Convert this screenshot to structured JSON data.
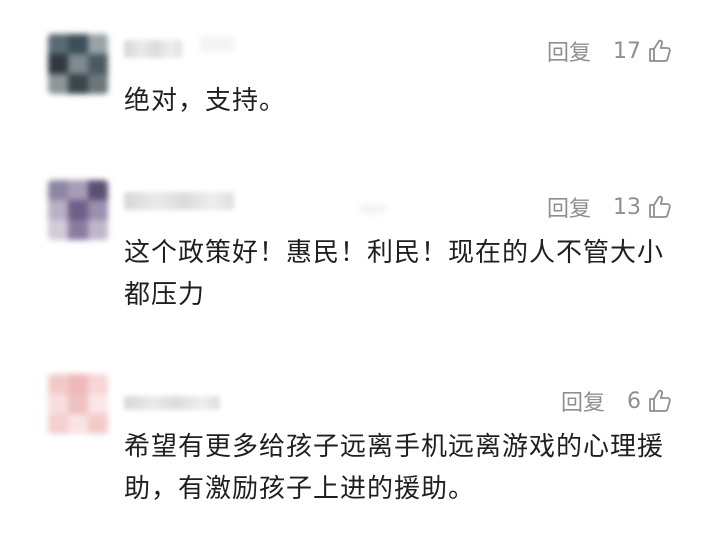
{
  "comments": [
    {
      "reply_label": "回复",
      "likes": "17",
      "text": "绝对，支持。"
    },
    {
      "reply_label": "回复",
      "likes": "13",
      "text": "这个政策好！惠民！利民！现在的人不管大小都压力"
    },
    {
      "reply_label": "回复",
      "likes": "6",
      "text": "希望有更多给孩子远离手机远离游戏的心理援助，有激励孩子上进的援助。"
    }
  ],
  "icons": {
    "like": "thumbs-up-outline-icon"
  },
  "colors": {
    "meta_text": "#8f8f8f",
    "body_text": "#1f1f1f",
    "background": "#ffffff"
  }
}
